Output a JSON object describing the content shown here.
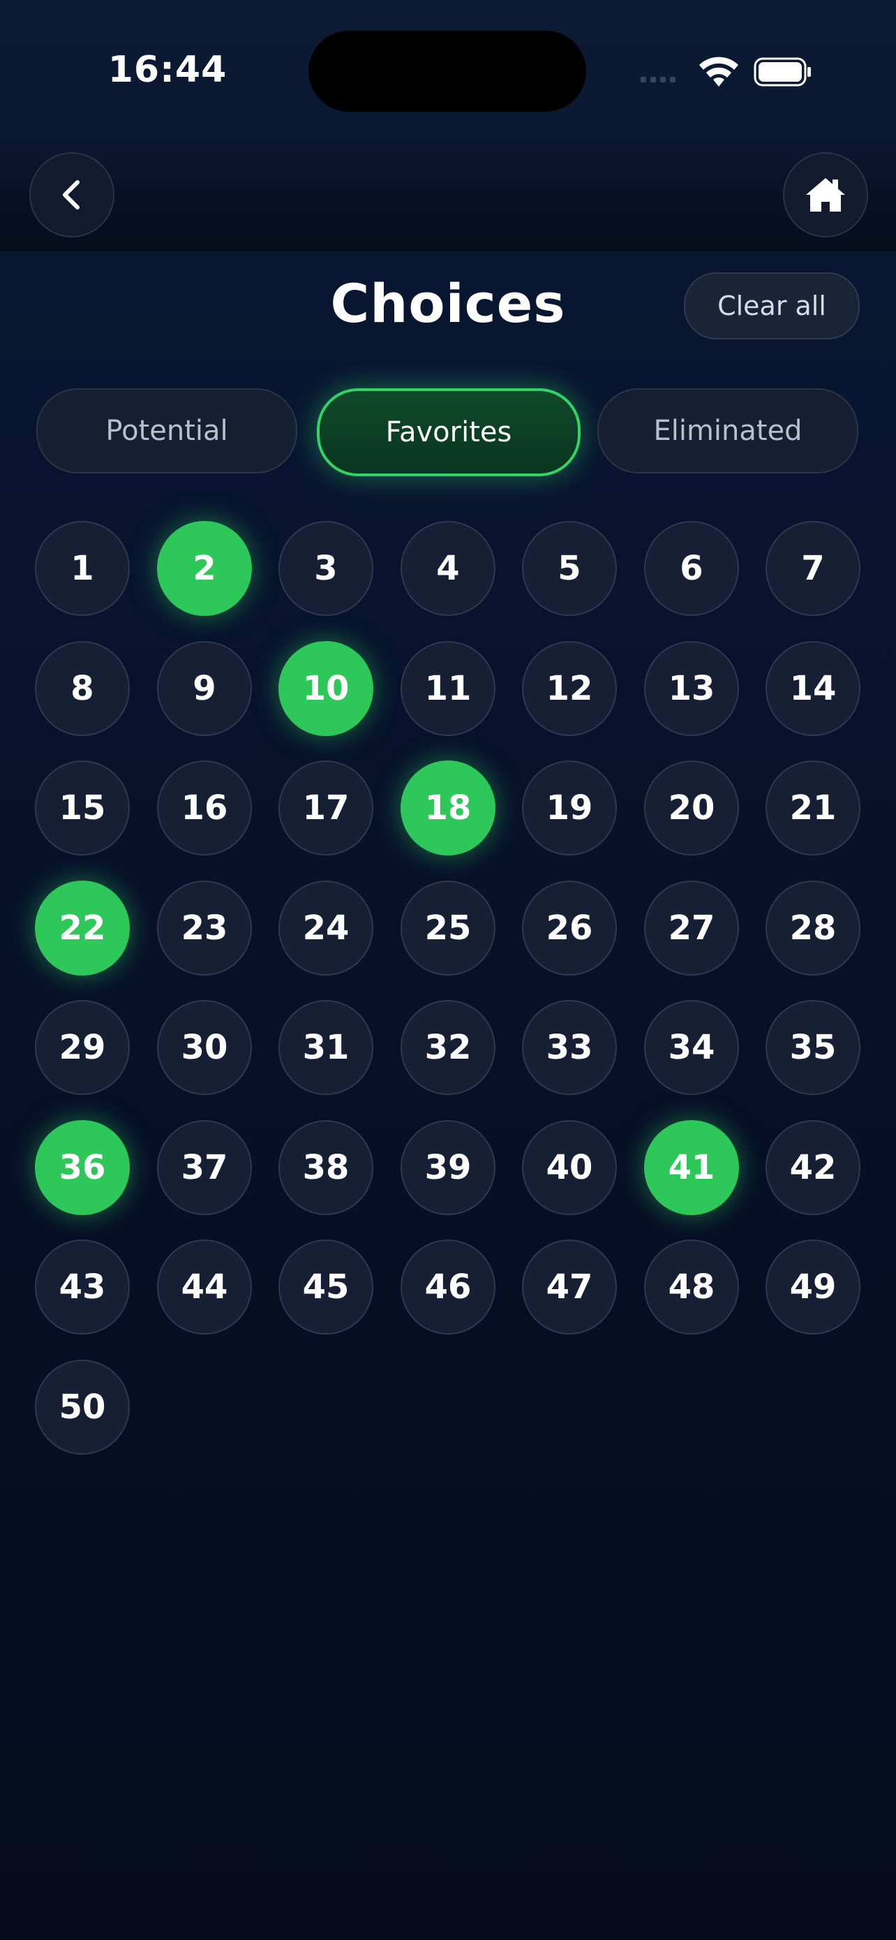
{
  "status": {
    "time": "16:44"
  },
  "header": {
    "title": "Choices",
    "clear_label": "Clear all"
  },
  "tabs": [
    {
      "label": "Potential",
      "active": false
    },
    {
      "label": "Favorites",
      "active": true
    },
    {
      "label": "Eliminated",
      "active": false
    }
  ],
  "numbers": [
    1,
    2,
    3,
    4,
    5,
    6,
    7,
    8,
    9,
    10,
    11,
    12,
    13,
    14,
    15,
    16,
    17,
    18,
    19,
    20,
    21,
    22,
    23,
    24,
    25,
    26,
    27,
    28,
    29,
    30,
    31,
    32,
    33,
    34,
    35,
    36,
    37,
    38,
    39,
    40,
    41,
    42,
    43,
    44,
    45,
    46,
    47,
    48,
    49,
    50
  ],
  "favorites": [
    2,
    10,
    18,
    22,
    36,
    41
  ],
  "colors": {
    "accent": "#2ec85a",
    "background": "#081530",
    "chip": "#161f33"
  },
  "icons": {
    "back": "chevron-left-icon",
    "home": "home-icon",
    "wifi": "wifi-icon",
    "battery": "battery-icon"
  }
}
